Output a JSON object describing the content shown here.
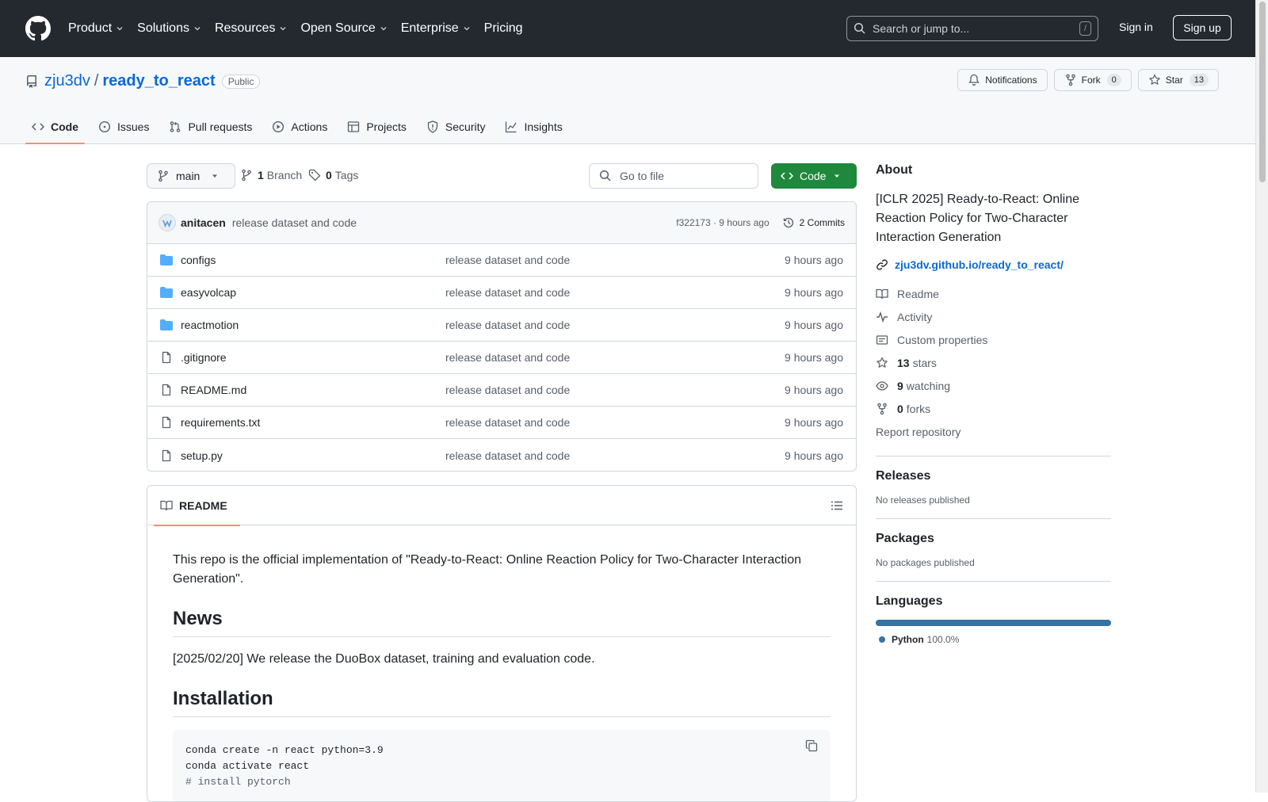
{
  "header": {
    "nav": [
      "Product",
      "Solutions",
      "Resources",
      "Open Source",
      "Enterprise",
      "Pricing"
    ],
    "search_placeholder": "Search or jump to...",
    "search_shortcut": "/",
    "sign_in": "Sign in",
    "sign_up": "Sign up"
  },
  "repo": {
    "owner": "zju3dv",
    "separator": "/",
    "name": "ready_to_react",
    "visibility": "Public",
    "notifications_label": "Notifications",
    "fork_label": "Fork",
    "fork_count": "0",
    "star_label": "Star",
    "star_count": "13"
  },
  "tabs": [
    "Code",
    "Issues",
    "Pull requests",
    "Actions",
    "Projects",
    "Security",
    "Insights"
  ],
  "toolbar": {
    "branch": "main",
    "branch_count": "1",
    "branch_label": "Branch",
    "tag_count": "0",
    "tag_label": "Tags",
    "goto_placeholder": "Go to file",
    "code_button": "Code"
  },
  "commit": {
    "author": "anitacen",
    "message": "release dataset and code",
    "hash_time": "f322173 · 9 hours ago",
    "commits_label": "2 Commits"
  },
  "files": [
    {
      "name": "configs",
      "type": "dir",
      "message": "release dataset and code",
      "time": "9 hours ago"
    },
    {
      "name": "easyvolcap",
      "type": "dir",
      "message": "release dataset and code",
      "time": "9 hours ago"
    },
    {
      "name": "reactmotion",
      "type": "dir",
      "message": "release dataset and code",
      "time": "9 hours ago"
    },
    {
      "name": ".gitignore",
      "type": "file",
      "message": "release dataset and code",
      "time": "9 hours ago"
    },
    {
      "name": "README.md",
      "type": "file",
      "message": "release dataset and code",
      "time": "9 hours ago"
    },
    {
      "name": "requirements.txt",
      "type": "file",
      "message": "release dataset and code",
      "time": "9 hours ago"
    },
    {
      "name": "setup.py",
      "type": "file",
      "message": "release dataset and code",
      "time": "9 hours ago"
    }
  ],
  "readme": {
    "tab_label": "README",
    "intro": "This repo is the official implementation of \"Ready-to-React: Online Reaction Policy for Two-Character Interaction Generation\".",
    "news_heading": "News",
    "news_text": "[2025/02/20] We release the DuoBox dataset, training and evaluation code.",
    "install_heading": "Installation",
    "code_lines": [
      "conda create -n react python=3.9",
      "conda activate react",
      "# install pytorch"
    ]
  },
  "about": {
    "heading": "About",
    "description": "[ICLR 2025] Ready-to-React: Online Reaction Policy for Two-Character Interaction Generation",
    "link": "zju3dv.github.io/ready_to_react/",
    "readme": "Readme",
    "activity": "Activity",
    "custom_properties": "Custom properties",
    "stars_count": "13",
    "stars_label": "stars",
    "watching_count": "9",
    "watching_label": "watching",
    "forks_count": "0",
    "forks_label": "forks",
    "report": "Report repository"
  },
  "releases": {
    "heading": "Releases",
    "text": "No releases published"
  },
  "packages": {
    "heading": "Packages",
    "text": "No packages published"
  },
  "languages": {
    "heading": "Languages",
    "name": "Python",
    "percent": "100.0%",
    "fraction": 1.0,
    "color": "#3572a5"
  }
}
